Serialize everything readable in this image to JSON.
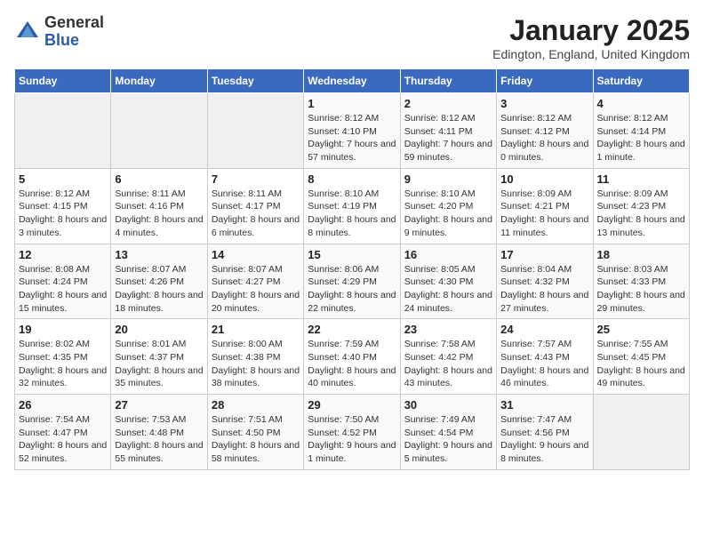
{
  "header": {
    "logo_line1": "General",
    "logo_line2": "Blue",
    "month": "January 2025",
    "location": "Edington, England, United Kingdom"
  },
  "weekdays": [
    "Sunday",
    "Monday",
    "Tuesday",
    "Wednesday",
    "Thursday",
    "Friday",
    "Saturday"
  ],
  "weeks": [
    [
      {
        "day": "",
        "info": ""
      },
      {
        "day": "",
        "info": ""
      },
      {
        "day": "",
        "info": ""
      },
      {
        "day": "1",
        "info": "Sunrise: 8:12 AM\nSunset: 4:10 PM\nDaylight: 7 hours and 57 minutes."
      },
      {
        "day": "2",
        "info": "Sunrise: 8:12 AM\nSunset: 4:11 PM\nDaylight: 7 hours and 59 minutes."
      },
      {
        "day": "3",
        "info": "Sunrise: 8:12 AM\nSunset: 4:12 PM\nDaylight: 8 hours and 0 minutes."
      },
      {
        "day": "4",
        "info": "Sunrise: 8:12 AM\nSunset: 4:14 PM\nDaylight: 8 hours and 1 minute."
      }
    ],
    [
      {
        "day": "5",
        "info": "Sunrise: 8:12 AM\nSunset: 4:15 PM\nDaylight: 8 hours and 3 minutes."
      },
      {
        "day": "6",
        "info": "Sunrise: 8:11 AM\nSunset: 4:16 PM\nDaylight: 8 hours and 4 minutes."
      },
      {
        "day": "7",
        "info": "Sunrise: 8:11 AM\nSunset: 4:17 PM\nDaylight: 8 hours and 6 minutes."
      },
      {
        "day": "8",
        "info": "Sunrise: 8:10 AM\nSunset: 4:19 PM\nDaylight: 8 hours and 8 minutes."
      },
      {
        "day": "9",
        "info": "Sunrise: 8:10 AM\nSunset: 4:20 PM\nDaylight: 8 hours and 9 minutes."
      },
      {
        "day": "10",
        "info": "Sunrise: 8:09 AM\nSunset: 4:21 PM\nDaylight: 8 hours and 11 minutes."
      },
      {
        "day": "11",
        "info": "Sunrise: 8:09 AM\nSunset: 4:23 PM\nDaylight: 8 hours and 13 minutes."
      }
    ],
    [
      {
        "day": "12",
        "info": "Sunrise: 8:08 AM\nSunset: 4:24 PM\nDaylight: 8 hours and 15 minutes."
      },
      {
        "day": "13",
        "info": "Sunrise: 8:07 AM\nSunset: 4:26 PM\nDaylight: 8 hours and 18 minutes."
      },
      {
        "day": "14",
        "info": "Sunrise: 8:07 AM\nSunset: 4:27 PM\nDaylight: 8 hours and 20 minutes."
      },
      {
        "day": "15",
        "info": "Sunrise: 8:06 AM\nSunset: 4:29 PM\nDaylight: 8 hours and 22 minutes."
      },
      {
        "day": "16",
        "info": "Sunrise: 8:05 AM\nSunset: 4:30 PM\nDaylight: 8 hours and 24 minutes."
      },
      {
        "day": "17",
        "info": "Sunrise: 8:04 AM\nSunset: 4:32 PM\nDaylight: 8 hours and 27 minutes."
      },
      {
        "day": "18",
        "info": "Sunrise: 8:03 AM\nSunset: 4:33 PM\nDaylight: 8 hours and 29 minutes."
      }
    ],
    [
      {
        "day": "19",
        "info": "Sunrise: 8:02 AM\nSunset: 4:35 PM\nDaylight: 8 hours and 32 minutes."
      },
      {
        "day": "20",
        "info": "Sunrise: 8:01 AM\nSunset: 4:37 PM\nDaylight: 8 hours and 35 minutes."
      },
      {
        "day": "21",
        "info": "Sunrise: 8:00 AM\nSunset: 4:38 PM\nDaylight: 8 hours and 38 minutes."
      },
      {
        "day": "22",
        "info": "Sunrise: 7:59 AM\nSunset: 4:40 PM\nDaylight: 8 hours and 40 minutes."
      },
      {
        "day": "23",
        "info": "Sunrise: 7:58 AM\nSunset: 4:42 PM\nDaylight: 8 hours and 43 minutes."
      },
      {
        "day": "24",
        "info": "Sunrise: 7:57 AM\nSunset: 4:43 PM\nDaylight: 8 hours and 46 minutes."
      },
      {
        "day": "25",
        "info": "Sunrise: 7:55 AM\nSunset: 4:45 PM\nDaylight: 8 hours and 49 minutes."
      }
    ],
    [
      {
        "day": "26",
        "info": "Sunrise: 7:54 AM\nSunset: 4:47 PM\nDaylight: 8 hours and 52 minutes."
      },
      {
        "day": "27",
        "info": "Sunrise: 7:53 AM\nSunset: 4:48 PM\nDaylight: 8 hours and 55 minutes."
      },
      {
        "day": "28",
        "info": "Sunrise: 7:51 AM\nSunset: 4:50 PM\nDaylight: 8 hours and 58 minutes."
      },
      {
        "day": "29",
        "info": "Sunrise: 7:50 AM\nSunset: 4:52 PM\nDaylight: 9 hours and 1 minute."
      },
      {
        "day": "30",
        "info": "Sunrise: 7:49 AM\nSunset: 4:54 PM\nDaylight: 9 hours and 5 minutes."
      },
      {
        "day": "31",
        "info": "Sunrise: 7:47 AM\nSunset: 4:56 PM\nDaylight: 9 hours and 8 minutes."
      },
      {
        "day": "",
        "info": ""
      }
    ]
  ]
}
